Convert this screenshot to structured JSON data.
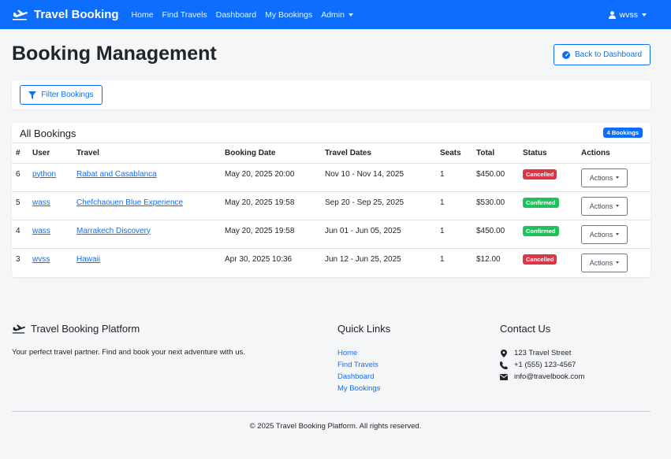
{
  "navbar": {
    "brand": "Travel Booking",
    "links": [
      "Home",
      "Find Travels",
      "Dashboard",
      "My Bookings"
    ],
    "admin_label": "Admin",
    "user_label": "wvss"
  },
  "page": {
    "title": "Booking Management",
    "back_label": "Back to Dashboard",
    "filter_label": "Filter Bookings"
  },
  "bookings": {
    "title": "All Bookings",
    "count_badge": "4 Bookings",
    "columns": [
      "#",
      "User",
      "Travel",
      "Booking Date",
      "Travel Dates",
      "Seats",
      "Total",
      "Status",
      "Actions"
    ],
    "rows": [
      {
        "id": "6",
        "user": "python",
        "travel": "Rabat and Casablanca",
        "booking_date": "May 20, 2025 20:00",
        "travel_dates": "Nov 10 - Nov 14, 2025",
        "seats": "1",
        "total": "$450.00",
        "status": "Cancelled",
        "action": "Actions"
      },
      {
        "id": "5",
        "user": "wass",
        "travel": "Chefchaouen Blue Experience",
        "booking_date": "May 20, 2025 19:58",
        "travel_dates": "Sep 20 - Sep 25, 2025",
        "seats": "1",
        "total": "$530.00",
        "status": "Confirmed",
        "action": "Actions"
      },
      {
        "id": "4",
        "user": "wass",
        "travel": "Marrakech Discovery",
        "booking_date": "May 20, 2025 19:58",
        "travel_dates": "Jun 01 - Jun 05, 2025",
        "seats": "1",
        "total": "$450.00",
        "status": "Confirmed",
        "action": "Actions"
      },
      {
        "id": "3",
        "user": "wvss",
        "travel": "Hawaii",
        "booking_date": "Apr 30, 2025 10:36",
        "travel_dates": "Jun 12 - Jun 25, 2025",
        "seats": "1",
        "total": "$12.00",
        "status": "Cancelled",
        "action": "Actions"
      }
    ]
  },
  "footer": {
    "brand_title": "Travel Booking Platform",
    "description": "Your perfect travel partner. Find and book your next adventure with us.",
    "quick_links_title": "Quick Links",
    "quick_links": [
      "Home",
      "Find Travels",
      "Dashboard",
      "My Bookings"
    ],
    "contact_title": "Contact Us",
    "address": "123 Travel Street",
    "phone": "+1 (555) 123-4567",
    "email": "info@travelbook.com",
    "copyright": "© 2025 Travel Booking Platform. All rights reserved."
  },
  "colors": {
    "primary": "#0d6efd",
    "cancelled": "#dc3545",
    "confirmed": "#20c05c"
  },
  "icons": [
    "plane-icon",
    "user-icon",
    "dashboard-icon",
    "filter-icon",
    "map-marker-icon",
    "phone-icon",
    "envelope-icon"
  ]
}
